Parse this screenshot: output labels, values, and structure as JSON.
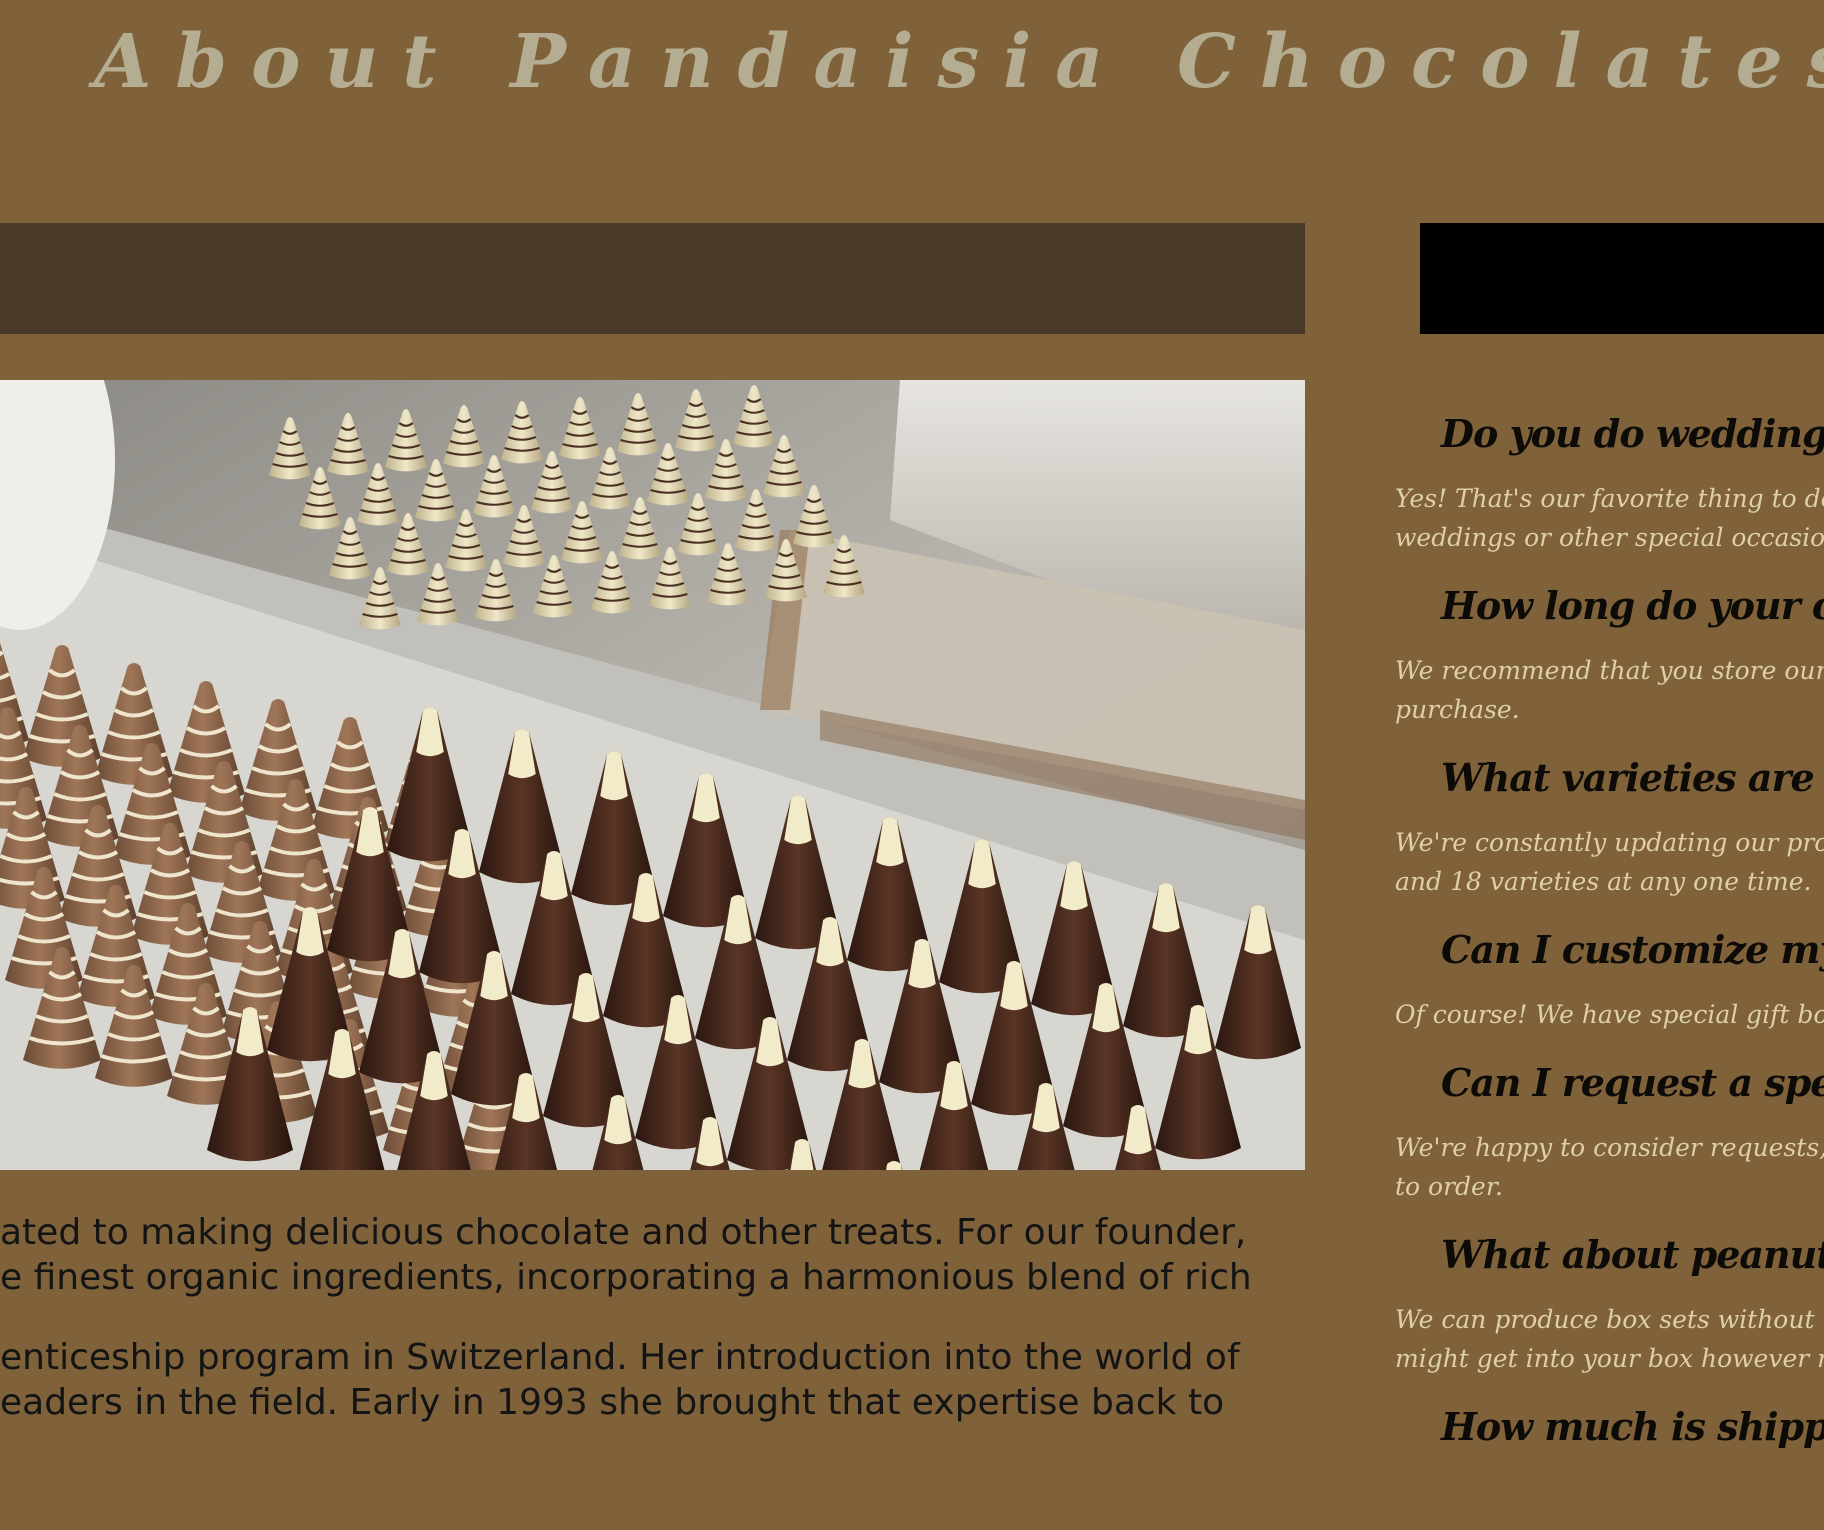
{
  "page": {
    "title": "About Pandaisia Chocolates"
  },
  "hero_image": {
    "alt": "Rows of cone-shaped chocolates with white tips and striped swirls next to clear chocolate molds on a steel table"
  },
  "about": {
    "paragraphs": [
      [
        "ated to making delicious chocolate and other treats. For our founder,",
        "e finest organic ingredients, incorporating a harmonious blend of rich"
      ],
      [
        "enticeship program in Switzerland. Her introduction into the world of",
        "eaders in the field. Early in 1993 she brought that expertise back to"
      ]
    ]
  },
  "faq": [
    {
      "q": "Do you do weddings?",
      "a": [
        "Yes! That's our favorite thing to do. We s",
        "weddings or other special occasions."
      ]
    },
    {
      "q": "How long do your chocol",
      "a": [
        "We recommend that you store our chocolates",
        "purchase."
      ]
    },
    {
      "q": "What varieties are you se",
      "a": [
        "We're constantly updating our product list t",
        "and 18 varieties at any one time."
      ]
    },
    {
      "q": "Can I customize my own",
      "a": [
        "Of course! We have special gift boxes but if"
      ]
    },
    {
      "q": "Can I request a special v",
      "a": [
        "We're happy to consider requests, but remem",
        "to order."
      ]
    },
    {
      "q": "What about peanut allerg",
      "a": [
        "We can produce box sets without nuts, but a",
        "might get into your box however much we try"
      ]
    },
    {
      "q": "How much is shipping?",
      "a": []
    }
  ]
}
